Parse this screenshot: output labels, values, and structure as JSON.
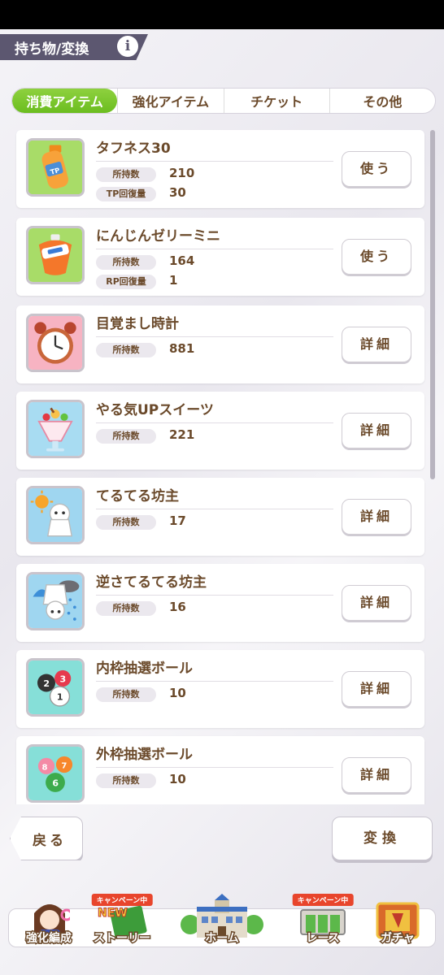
{
  "header": {
    "title": "持ち物/変換",
    "info_icon": "i"
  },
  "tabs": [
    {
      "label": "消費アイテム",
      "active": true
    },
    {
      "label": "強化アイテム",
      "active": false
    },
    {
      "label": "チケット",
      "active": false
    },
    {
      "label": "その他",
      "active": false
    }
  ],
  "items": [
    {
      "name": "タフネス30",
      "icon": "tp-bottle-icon",
      "stats": [
        {
          "label": "所持数",
          "value": "210"
        },
        {
          "label": "TP回復量",
          "value": "30"
        }
      ],
      "button": "使う"
    },
    {
      "name": "にんじんゼリーミニ",
      "icon": "carrot-jelly-icon",
      "stats": [
        {
          "label": "所持数",
          "value": "164"
        },
        {
          "label": "RP回復量",
          "value": "1"
        }
      ],
      "button": "使う"
    },
    {
      "name": "目覚まし時計",
      "icon": "alarm-clock-icon",
      "stats": [
        {
          "label": "所持数",
          "value": "881"
        }
      ],
      "button": "詳細"
    },
    {
      "name": "やる気UPスイーツ",
      "icon": "parfait-icon",
      "stats": [
        {
          "label": "所持数",
          "value": "221"
        }
      ],
      "button": "詳細"
    },
    {
      "name": "てるてる坊主",
      "icon": "teru-teru-bozu-sun-icon",
      "stats": [
        {
          "label": "所持数",
          "value": "17"
        }
      ],
      "button": "詳細"
    },
    {
      "name": "逆さてるてる坊主",
      "icon": "teru-teru-bozu-rain-icon",
      "stats": [
        {
          "label": "所持数",
          "value": "16"
        }
      ],
      "button": "詳細"
    },
    {
      "name": "内枠抽選ボール",
      "icon": "inner-lottery-ball-icon",
      "stats": [
        {
          "label": "所持数",
          "value": "10"
        }
      ],
      "button": "詳細"
    },
    {
      "name": "外枠抽選ボール",
      "icon": "outer-lottery-ball-icon",
      "stats": [
        {
          "label": "所持数",
          "value": "10"
        }
      ],
      "button": "詳細"
    }
  ],
  "footer": {
    "back": "戻る",
    "convert": "変換"
  },
  "nav": [
    {
      "label": "強化編成",
      "badge": ""
    },
    {
      "label": "ストーリー",
      "badge": "キャンペーン中",
      "extra": "NEW"
    },
    {
      "label": "ホーム",
      "badge": ""
    },
    {
      "label": "レース",
      "badge": "キャンペーン中"
    },
    {
      "label": "ガチャ",
      "badge": ""
    }
  ],
  "colors": {
    "tab_active": "#7cc62f",
    "text_brown": "#6b4a2b",
    "header_bg": "#5c5770",
    "campaign_badge": "#e8452c"
  }
}
